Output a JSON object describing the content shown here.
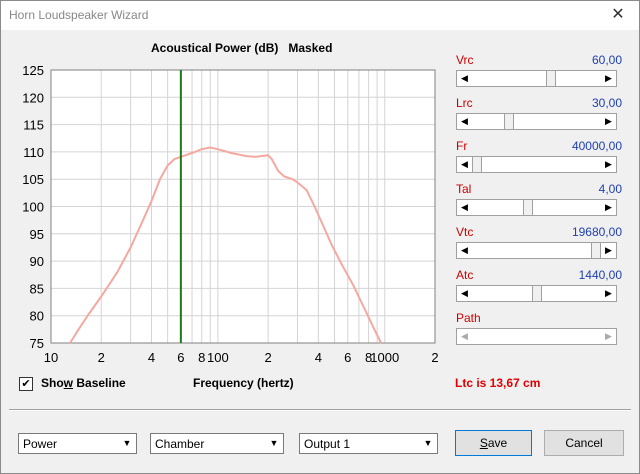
{
  "window": {
    "title": "Horn Loudspeaker Wizard",
    "close_glyph": "✕"
  },
  "chart_data": {
    "type": "line",
    "title": "Acoustical Power (dB)",
    "subtitle": "Masked",
    "xlabel": "Frequency (hertz)",
    "ylabel": "",
    "xscale": "log",
    "xlim": [
      10,
      2000
    ],
    "ylim": [
      75,
      125
    ],
    "yticks": [
      75,
      80,
      85,
      90,
      95,
      100,
      105,
      110,
      115,
      120,
      125
    ],
    "xticks": [
      {
        "v": 10,
        "label": "10"
      },
      {
        "v": 20,
        "label": "2"
      },
      {
        "v": 40,
        "label": "4"
      },
      {
        "v": 60,
        "label": "6"
      },
      {
        "v": 80,
        "label": "8"
      },
      {
        "v": 100,
        "label": "100"
      },
      {
        "v": 200,
        "label": "2"
      },
      {
        "v": 400,
        "label": "4"
      },
      {
        "v": 600,
        "label": "6"
      },
      {
        "v": 800,
        "label": "8"
      },
      {
        "v": 1000,
        "label": "1000"
      },
      {
        "v": 2000,
        "label": "2"
      }
    ],
    "grid": true,
    "marker_x": 60,
    "marker_color": "#1a7a1a",
    "series": [
      {
        "color": "#f5a8a0",
        "points": [
          [
            13,
            75
          ],
          [
            15,
            78
          ],
          [
            17,
            80.5
          ],
          [
            20,
            83.5
          ],
          [
            25,
            88
          ],
          [
            30,
            92.5
          ],
          [
            35,
            97
          ],
          [
            40,
            101
          ],
          [
            45,
            105
          ],
          [
            50,
            107.5
          ],
          [
            55,
            108.7
          ],
          [
            60,
            109.1
          ],
          [
            70,
            109.8
          ],
          [
            80,
            110.5
          ],
          [
            90,
            110.8
          ],
          [
            100,
            110.5
          ],
          [
            120,
            109.8
          ],
          [
            150,
            109.2
          ],
          [
            170,
            109.1
          ],
          [
            200,
            109.4
          ],
          [
            210,
            108.7
          ],
          [
            230,
            106.5
          ],
          [
            250,
            105.5
          ],
          [
            280,
            105
          ],
          [
            300,
            104.4
          ],
          [
            340,
            103
          ],
          [
            380,
            100
          ],
          [
            420,
            97
          ],
          [
            480,
            93
          ],
          [
            550,
            89.5
          ],
          [
            650,
            85.5
          ],
          [
            750,
            81.5
          ],
          [
            850,
            78
          ],
          [
            950,
            75
          ]
        ]
      }
    ]
  },
  "params": [
    {
      "label": "Vrc",
      "value": "60,00",
      "pos": 0.62
    },
    {
      "label": "Lrc",
      "value": "30,00",
      "pos": 0.27
    },
    {
      "label": "Fr",
      "value": "40000,00",
      "pos": 0.0
    },
    {
      "label": "Tal",
      "value": "4,00",
      "pos": 0.43
    },
    {
      "label": "Vtc",
      "value": "19680,00",
      "pos": 1.0
    },
    {
      "label": "Atc",
      "value": "1440,00",
      "pos": 0.5
    },
    {
      "label": "Path",
      "value": "",
      "pos": null
    }
  ],
  "baseline": {
    "checked": true,
    "label": "Show Baseline",
    "check_glyph": "✔"
  },
  "ltc_text": "Ltc is 13,67 cm",
  "combos": {
    "power": "Power",
    "chamber": "Chamber",
    "output": "Output 1",
    "arrow": "▼"
  },
  "buttons": {
    "save": "Save",
    "cancel": "Cancel"
  },
  "arrows": {
    "left": "◀",
    "right": "▶"
  }
}
